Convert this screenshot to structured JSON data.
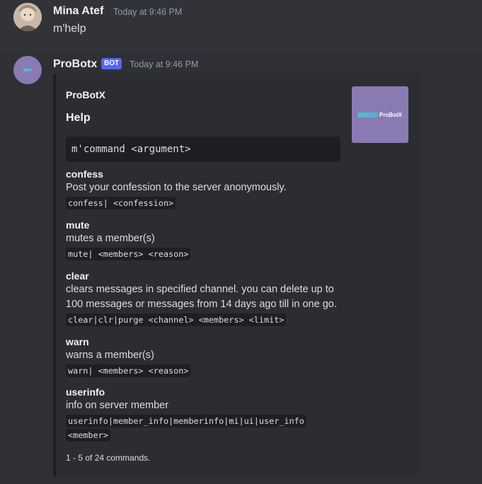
{
  "messages": [
    {
      "username": "Mina Atef",
      "timestamp": "Today at 9:46 PM",
      "content": "m'help"
    },
    {
      "username": "ProBotx",
      "bot_tag": "BOT",
      "timestamp": "Today at 9:46 PM",
      "embed": {
        "author": "ProBotX",
        "title": "Help",
        "thumbnail_text": "ProBotX",
        "code_block": "m'command <argument>",
        "fields": [
          {
            "name": "confess",
            "value": "Post your confession to the server anonymously.",
            "code": "confess| <confession>"
          },
          {
            "name": "mute",
            "value": "mutes a member(s)",
            "code": "mute| <members> <reason>"
          },
          {
            "name": "clear",
            "value": "clears messages in specified channel. you can delete up to 100 messages or messages from 14 days ago till in one go.",
            "code": "clear|clr|purge <channel> <members> <limit>"
          },
          {
            "name": "warn",
            "value": "warns a member(s)",
            "code": "warn| <members> <reason>"
          },
          {
            "name": "userinfo",
            "value": "info on server member",
            "code": "userinfo|member_info|memberinfo|mi|ui|user_info",
            "code2": "<member>"
          }
        ],
        "footer": "1 - 5 of 24 commands."
      }
    }
  ],
  "colors": {
    "background": "#313338",
    "embed_bg": "#2b2d31",
    "code_bg": "#1e1f22",
    "bot_tag": "#5865f2",
    "bot_avatar": "#8a7ab3"
  }
}
